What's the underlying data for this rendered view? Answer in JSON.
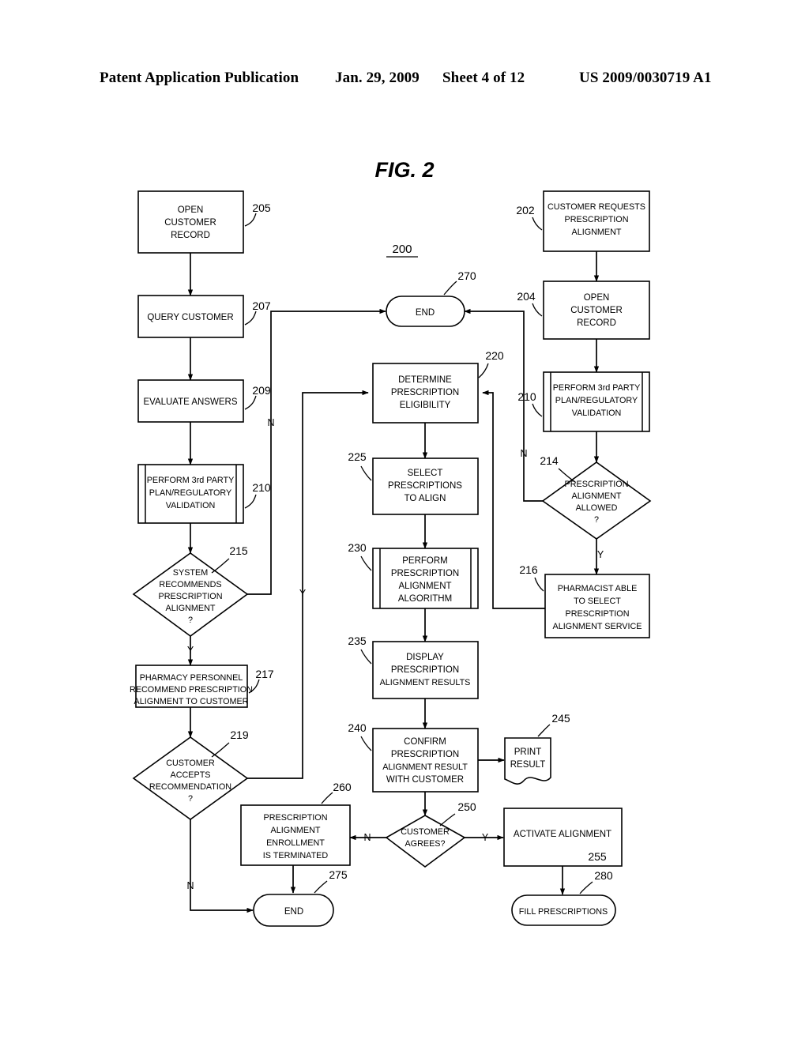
{
  "header": {
    "publication": "Patent Application Publication",
    "date": "Jan. 29, 2009",
    "sheet": "Sheet 4 of 12",
    "number": "US 2009/0030719 A1"
  },
  "figure": {
    "title": "FIG. 2",
    "diagram_number": "200"
  },
  "nodes": {
    "n205": {
      "ref": "205",
      "text": [
        "OPEN",
        "CUSTOMER",
        "RECORD"
      ],
      "shape": "process"
    },
    "n207": {
      "ref": "207",
      "text": [
        "QUERY CUSTOMER"
      ],
      "shape": "process"
    },
    "n209": {
      "ref": "209",
      "text": [
        "EVALUATE ANSWERS"
      ],
      "shape": "process"
    },
    "n210L": {
      "ref": "210",
      "text": [
        "PERFORM 3rd PARTY",
        "PLAN/REGULATORY",
        "VALIDATION"
      ],
      "shape": "predefined-process"
    },
    "n215": {
      "ref": "215",
      "text": [
        "SYSTEM",
        "RECOMMENDS",
        "PRESCRIPTION",
        "ALIGNMENT",
        "?"
      ],
      "shape": "decision"
    },
    "n217": {
      "ref": "217",
      "text": [
        "PHARMACY PERSONNEL",
        "RECOMMEND PRESCRIPTION",
        "ALIGNMENT TO CUSTOMER"
      ],
      "shape": "process"
    },
    "n219": {
      "ref": "219",
      "text": [
        "CUSTOMER",
        "ACCEPTS",
        "RECOMMENDATION",
        "?"
      ],
      "shape": "decision"
    },
    "n202": {
      "ref": "202",
      "text": [
        "CUSTOMER REQUESTS",
        "PRESCRIPTION",
        "ALIGNMENT"
      ],
      "shape": "process"
    },
    "n204": {
      "ref": "204",
      "text": [
        "OPEN",
        "CUSTOMER",
        "RECORD"
      ],
      "shape": "process"
    },
    "n210R": {
      "ref": "210",
      "text": [
        "PERFORM 3rd PARTY",
        "PLAN/REGULATORY",
        "VALIDATION"
      ],
      "shape": "predefined-process"
    },
    "n214": {
      "ref": "214",
      "text": [
        "PRESCRIPTION",
        "ALIGNMENT",
        "ALLOWED",
        "?"
      ],
      "shape": "decision"
    },
    "n216": {
      "ref": "216",
      "text": [
        "PHARMACIST ABLE",
        "TO SELECT",
        "PRESCRIPTION",
        "ALIGNMENT SERVICE"
      ],
      "shape": "process"
    },
    "n270": {
      "ref": "270",
      "text": [
        "END"
      ],
      "shape": "terminator"
    },
    "n220": {
      "ref": "220",
      "text": [
        "DETERMINE",
        "PRESCRIPTION",
        "ELIGIBILITY"
      ],
      "shape": "process"
    },
    "n225": {
      "ref": "225",
      "text": [
        "SELECT",
        "PRESCRIPTIONS",
        "TO ALIGN"
      ],
      "shape": "process"
    },
    "n230": {
      "ref": "230",
      "text": [
        "PERFORM",
        "PRESCRIPTION",
        "ALIGNMENT",
        "ALGORITHM"
      ],
      "shape": "predefined-process"
    },
    "n235": {
      "ref": "235",
      "text": [
        "DISPLAY",
        "PRESCRIPTION",
        "ALIGNMENT RESULTS"
      ],
      "shape": "process"
    },
    "n240": {
      "ref": "240",
      "text": [
        "CONFIRM",
        "PRESCRIPTION",
        "ALIGNMENT RESULT",
        "WITH CUSTOMER"
      ],
      "shape": "process"
    },
    "n245": {
      "ref": "245",
      "text": [
        "PRINT",
        "RESULT"
      ],
      "shape": "document"
    },
    "n250": {
      "ref": "250",
      "text": [
        "CUSTOMER",
        "AGREES?"
      ],
      "shape": "decision"
    },
    "n255": {
      "ref": "255",
      "text": [
        "ACTIVATE ALIGNMENT"
      ],
      "shape": "process"
    },
    "n260": {
      "ref": "260",
      "text": [
        "PRESCRIPTION",
        "ALIGNMENT",
        "ENROLLMENT",
        "IS TERMINATED"
      ],
      "shape": "process"
    },
    "n275": {
      "ref": "275",
      "text": [
        "END"
      ],
      "shape": "terminator"
    },
    "n280": {
      "ref": "280",
      "text": [
        "FILL PRESCRIPTIONS"
      ],
      "shape": "terminator"
    }
  },
  "edge_labels": {
    "e215_no": "N",
    "e215_yes": "Y",
    "e219_yes": "Y",
    "e219_no": "N",
    "e214_no": "N",
    "e214_yes": "Y",
    "e250_no": "N",
    "e250_yes": "Y"
  }
}
